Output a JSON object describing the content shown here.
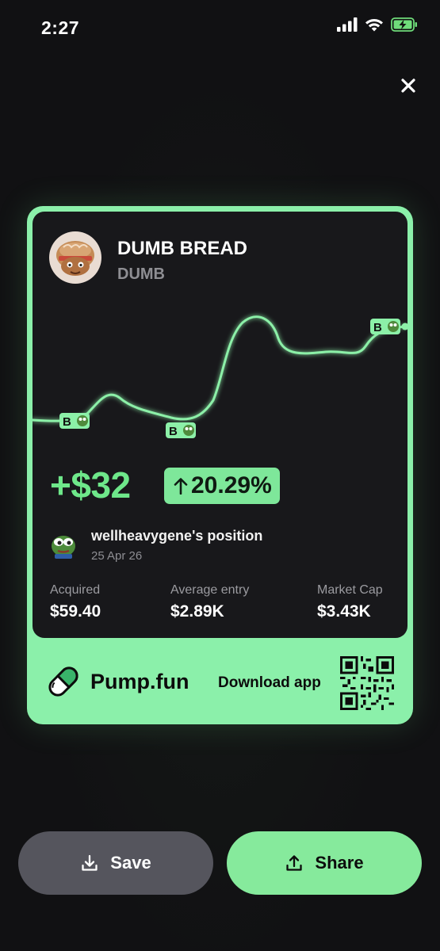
{
  "status_bar": {
    "time": "2:27"
  },
  "token": {
    "name": "DUMB BREAD",
    "ticker": "DUMB"
  },
  "pnl": {
    "amount": "+$32",
    "percent": "20.29%"
  },
  "position": {
    "label": "wellheavygene's position",
    "date": "25 Apr 26"
  },
  "stats": [
    {
      "label": "Acquired",
      "value": "$59.40"
    },
    {
      "label": "Average entry",
      "value": "$2.89K"
    },
    {
      "label": "Market Cap",
      "value": "$3.43K"
    }
  ],
  "brand": {
    "name": "Pump.fun",
    "download_label": "Download app"
  },
  "actions": {
    "save_label": "Save",
    "share_label": "Share"
  },
  "chart_markers": [
    "B",
    "B",
    "B"
  ],
  "colors": {
    "accent": "#86ea9c",
    "gain": "#6ee78a",
    "card_bg": "#18181b"
  }
}
